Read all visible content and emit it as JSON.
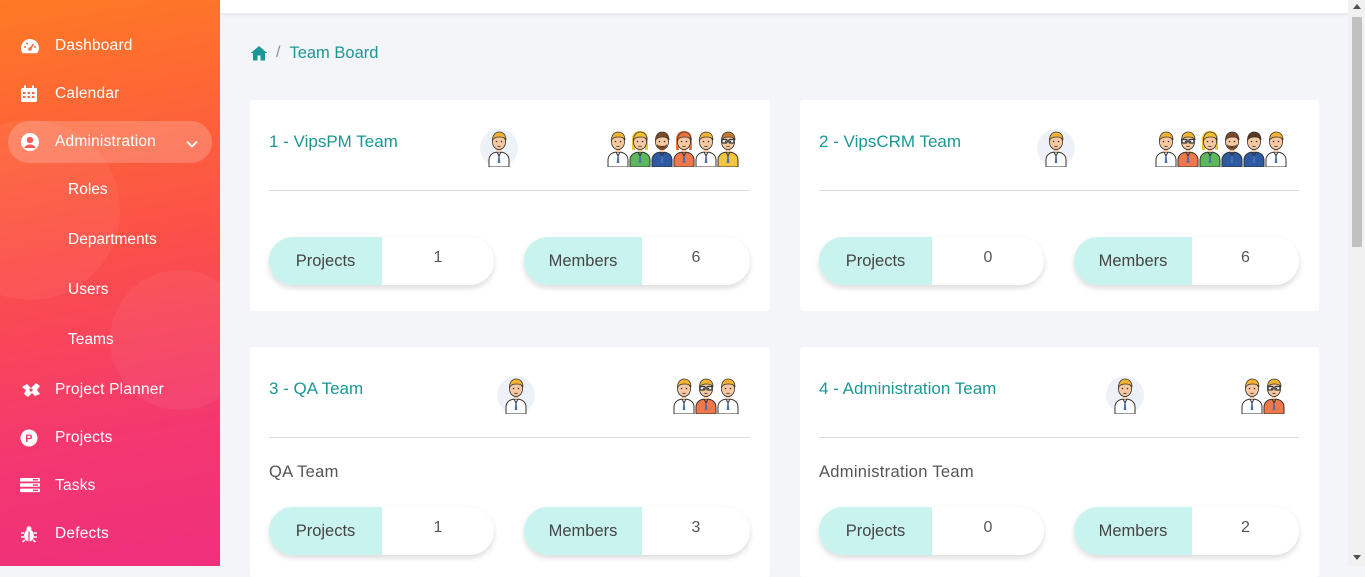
{
  "sidebar": {
    "items": [
      {
        "label": "Dashboard",
        "icon": "dashboard-icon"
      },
      {
        "label": "Calendar",
        "icon": "calendar-icon"
      },
      {
        "label": "Administration",
        "icon": "user-circle-icon",
        "active": true
      },
      {
        "label": "Project Planner",
        "icon": "project-planner-icon"
      },
      {
        "label": "Projects",
        "icon": "projects-icon"
      },
      {
        "label": "Tasks",
        "icon": "tasks-icon"
      },
      {
        "label": "Defects",
        "icon": "bug-icon"
      }
    ],
    "submenu": [
      {
        "label": "Roles"
      },
      {
        "label": "Departments"
      },
      {
        "label": "Users"
      },
      {
        "label": "Teams"
      }
    ]
  },
  "breadcrumb": {
    "home_icon": "home-icon",
    "separator": "/",
    "current": "Team Board"
  },
  "teams": [
    {
      "title": "1 - VipsPM Team",
      "description": "",
      "projects_label": "Projects",
      "projects": "1",
      "members_label": "Members",
      "members": "6",
      "member_avatars": [
        "m-blond",
        "f-blond",
        "m-beard",
        "f-red",
        "m-blond",
        "m-glasses-yellow"
      ]
    },
    {
      "title": "2 - VipsCRM Team",
      "description": "",
      "projects_label": "Projects",
      "projects": "0",
      "members_label": "Members",
      "members": "6",
      "member_avatars": [
        "m-blond",
        "m-glasses-orange",
        "f-blond",
        "m-beard",
        "m-dark",
        "m-blond"
      ]
    },
    {
      "title": "3 - QA Team",
      "description": "QA Team",
      "projects_label": "Projects",
      "projects": "1",
      "members_label": "Members",
      "members": "3",
      "member_avatars": [
        "m-blond",
        "m-glasses-orange",
        "m-blond"
      ]
    },
    {
      "title": "4 - Administration Team",
      "description": "Administration Team",
      "projects_label": "Projects",
      "projects": "0",
      "members_label": "Members",
      "members": "2",
      "member_avatars": [
        "m-blond",
        "m-glasses-orange"
      ]
    }
  ],
  "colors": {
    "accent": "#1b9796",
    "stat_label_bg": "#c9f3ee",
    "sidebar_top": "#ff7a24",
    "sidebar_bottom": "#ef2f7c"
  }
}
